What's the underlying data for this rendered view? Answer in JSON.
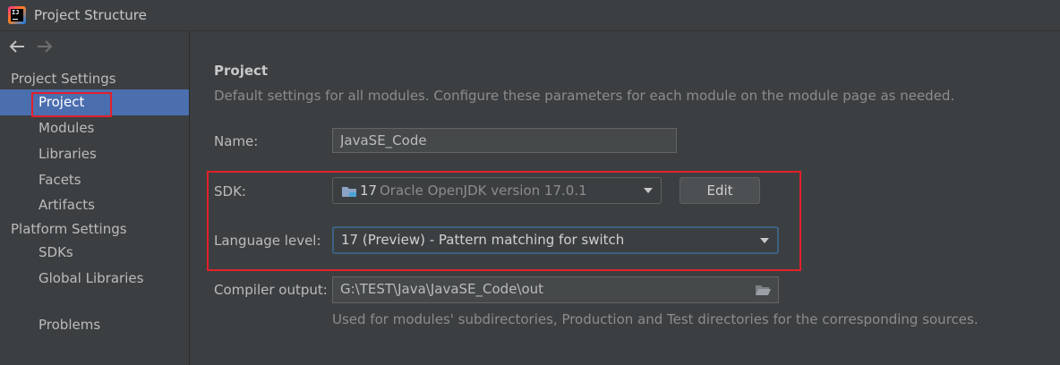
{
  "window": {
    "title": "Project Structure",
    "app_icon_text": "IJ"
  },
  "sidebar": {
    "back_icon": "arrow-left-icon",
    "forward_icon": "arrow-right-icon",
    "project_settings_label": "Project Settings",
    "project_items": [
      "Project",
      "Modules",
      "Libraries",
      "Facets",
      "Artifacts"
    ],
    "platform_settings_label": "Platform Settings",
    "platform_items": [
      "SDKs",
      "Global Libraries"
    ],
    "problems_label": "Problems",
    "selected": "Project"
  },
  "main": {
    "section_title": "Project",
    "section_desc": "Default settings for all modules. Configure these parameters for each module on the module page as needed.",
    "name_label": "Name:",
    "name_value": "JavaSE_Code",
    "sdk_label": "SDK:",
    "sdk_version": "17",
    "sdk_desc": "Oracle OpenJDK version 17.0.1",
    "edit_label": "Edit",
    "language_level_label": "Language level:",
    "language_level_value": "17 (Preview) - Pattern matching for switch",
    "compiler_output_label": "Compiler output:",
    "compiler_output_value": "G:\\TEST\\Java\\JavaSE_Code\\out",
    "compiler_output_hint": "Used for modules' subdirectories, Production and Test directories for the corresponding sources."
  },
  "colors": {
    "background": "#3c3f41",
    "selection": "#4b6eaf",
    "annotation_red": "#e3202a",
    "focus_border": "#3d6185"
  }
}
